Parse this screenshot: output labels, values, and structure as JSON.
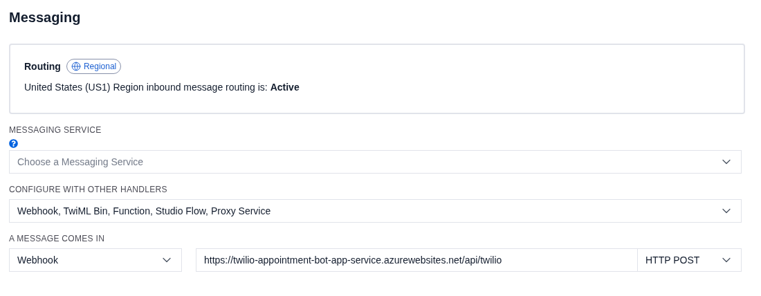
{
  "title": "Messaging",
  "routing": {
    "title": "Routing",
    "badge": "Regional",
    "status": "United States (US1) Region inbound message routing is: **Active**"
  },
  "messaging_service": {
    "label": "MESSAGING SERVICE",
    "placeholder": "Choose a Messaging Service"
  },
  "configure_with": {
    "label": "CONFIGURE WITH OTHER HANDLERS",
    "value": "Webhook, TwiML Bin, Function, Studio Flow, Proxy Service"
  },
  "message_comes_in": {
    "label": "A MESSAGE COMES IN",
    "handler": "Webhook",
    "url": "https://twilio-appointment-bot-app-service.azurewebsites.net/api/twilio",
    "method": "HTTP POST"
  }
}
